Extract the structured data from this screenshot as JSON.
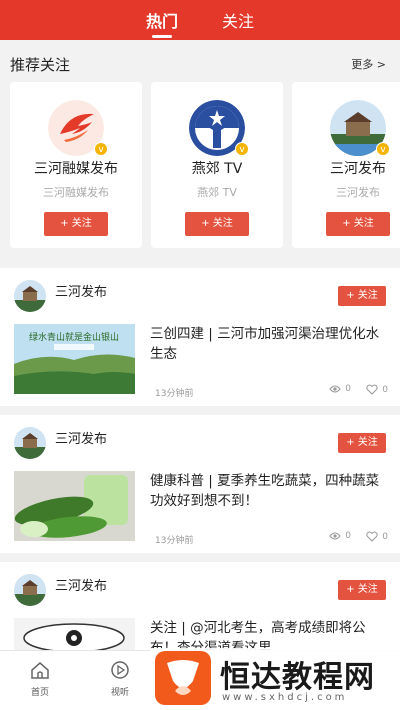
{
  "tabs": [
    {
      "label": "热门",
      "active": true
    },
    {
      "label": "关注",
      "active": false
    }
  ],
  "recommend": {
    "title": "推荐关注",
    "more": "更多 >",
    "cards": [
      {
        "name": "三河融媒发布",
        "sub": "三河融媒发布",
        "follow": "+ 关注",
        "verified": "v"
      },
      {
        "name": "燕郊 TV",
        "sub": "燕郊 TV",
        "follow": "+ 关注",
        "verified": "v"
      },
      {
        "name": "三河发布",
        "sub": "三河发布",
        "follow": "+ 关注",
        "verified": "v"
      }
    ]
  },
  "feed": [
    {
      "author": "三河发布",
      "follow": "+ 关注",
      "title": "三创四建 | 三河市加强河渠治理优化水生态",
      "time": "13分钟前",
      "views": "0",
      "likes": "0"
    },
    {
      "author": "三河发布",
      "follow": "+ 关注",
      "title": "健康科普 | 夏季养生吃蔬菜，四种蔬菜功效好到想不到！",
      "time": "13分钟前",
      "views": "0",
      "likes": "0"
    },
    {
      "author": "三河发布",
      "follow": "+ 关注",
      "title": "关注 | @河北考生，高考成绩即将公布！查分渠道看这里",
      "time": "",
      "views": "",
      "likes": ""
    }
  ],
  "thumb_text": "绿水青山就是金山银山",
  "bottom_nav": [
    {
      "label": "首页",
      "icon": "home-icon"
    },
    {
      "label": "视听",
      "icon": "play-icon"
    }
  ],
  "watermark": {
    "name": "恒达教程网",
    "url": "www.sxhdcj.com"
  },
  "colors": {
    "brand_red": "#e4382b",
    "follow_button": "#e4533f",
    "verified": "#f4b400"
  }
}
